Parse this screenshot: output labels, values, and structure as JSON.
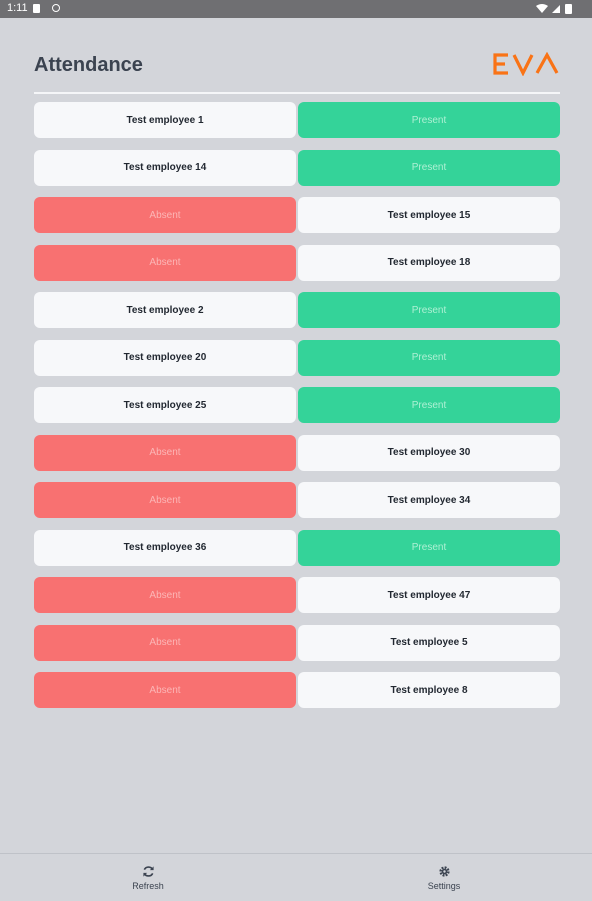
{
  "status_bar": {
    "time": "1:11"
  },
  "header": {
    "title": "Attendance",
    "logo_text": "EVA"
  },
  "colors": {
    "present": "#34d399",
    "absent": "#f87171",
    "logo": "#f97316"
  },
  "rows": [
    {
      "employee": "Test employee 1",
      "status": "Present",
      "status_side": "right"
    },
    {
      "employee": "Test employee 14",
      "status": "Present",
      "status_side": "right"
    },
    {
      "employee": "Test employee 15",
      "status": "Absent",
      "status_side": "left"
    },
    {
      "employee": "Test employee 18",
      "status": "Absent",
      "status_side": "left"
    },
    {
      "employee": "Test employee 2",
      "status": "Present",
      "status_side": "right"
    },
    {
      "employee": "Test employee 20",
      "status": "Present",
      "status_side": "right"
    },
    {
      "employee": "Test employee 25",
      "status": "Present",
      "status_side": "right"
    },
    {
      "employee": "Test employee 30",
      "status": "Absent",
      "status_side": "left"
    },
    {
      "employee": "Test employee 34",
      "status": "Absent",
      "status_side": "left"
    },
    {
      "employee": "Test employee 36",
      "status": "Present",
      "status_side": "right"
    },
    {
      "employee": "Test employee 47",
      "status": "Absent",
      "status_side": "left"
    },
    {
      "employee": "Test employee 5",
      "status": "Absent",
      "status_side": "left"
    },
    {
      "employee": "Test employee 8",
      "status": "Absent",
      "status_side": "left"
    }
  ],
  "bottom_nav": {
    "refresh_label": "Refresh",
    "settings_label": "Settings",
    "refresh_icon": "refresh-icon",
    "settings_icon": "gear-icon"
  }
}
